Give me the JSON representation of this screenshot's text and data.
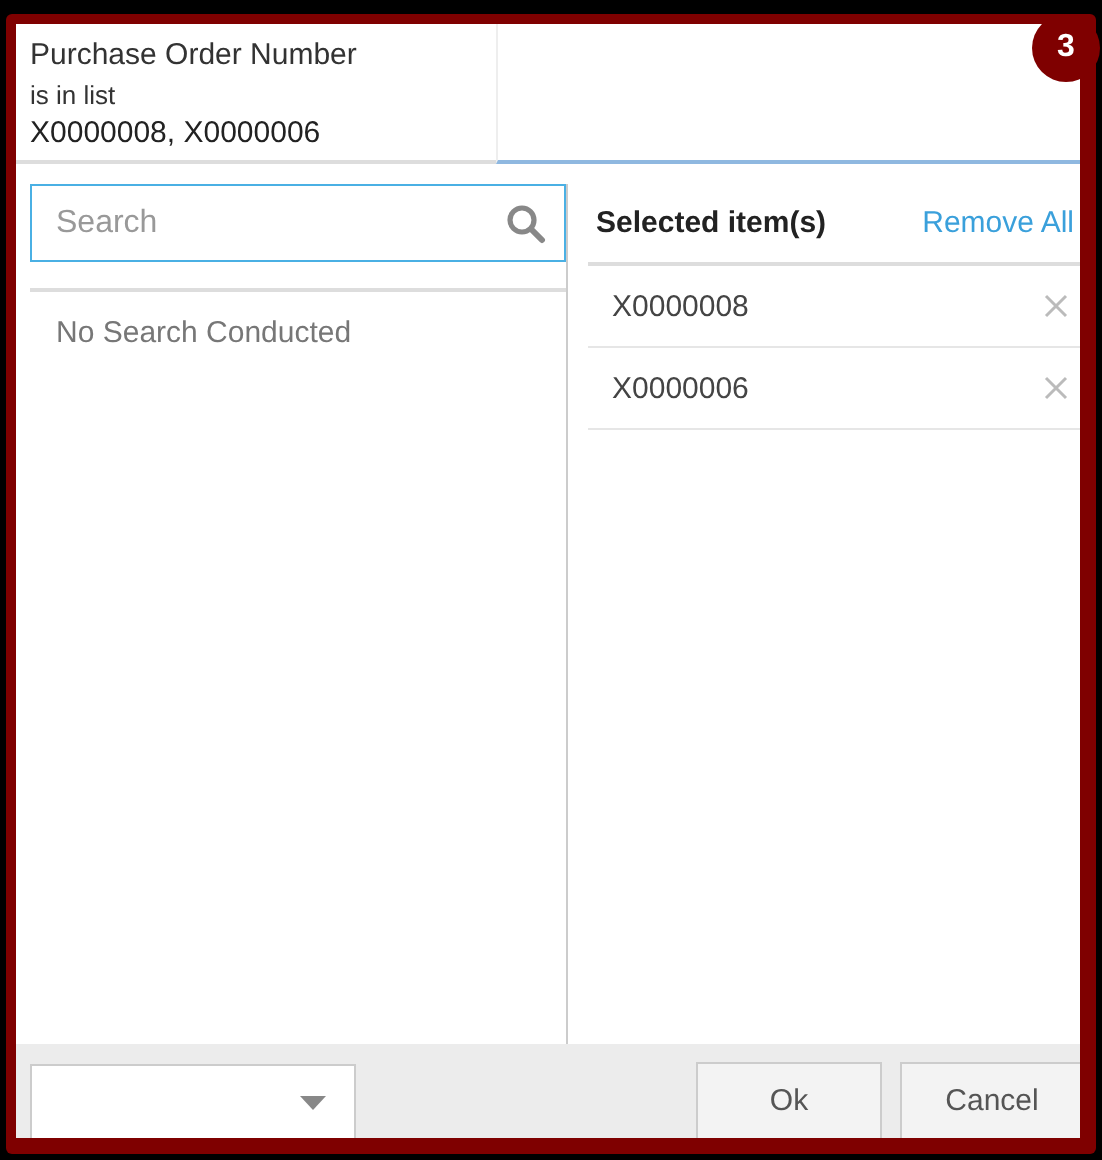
{
  "badge": "3",
  "header": {
    "field": "Purchase Order Number",
    "operator": "is in list",
    "values": "X0000008, X0000006"
  },
  "search": {
    "placeholder": "Search"
  },
  "empty_message": "No Search Conducted",
  "selected": {
    "title": "Selected item(s)",
    "remove_all": "Remove All",
    "items": [
      {
        "label": "X0000008"
      },
      {
        "label": "X0000006"
      }
    ]
  },
  "buttons": [
    "Ok",
    "Cancel"
  ]
}
